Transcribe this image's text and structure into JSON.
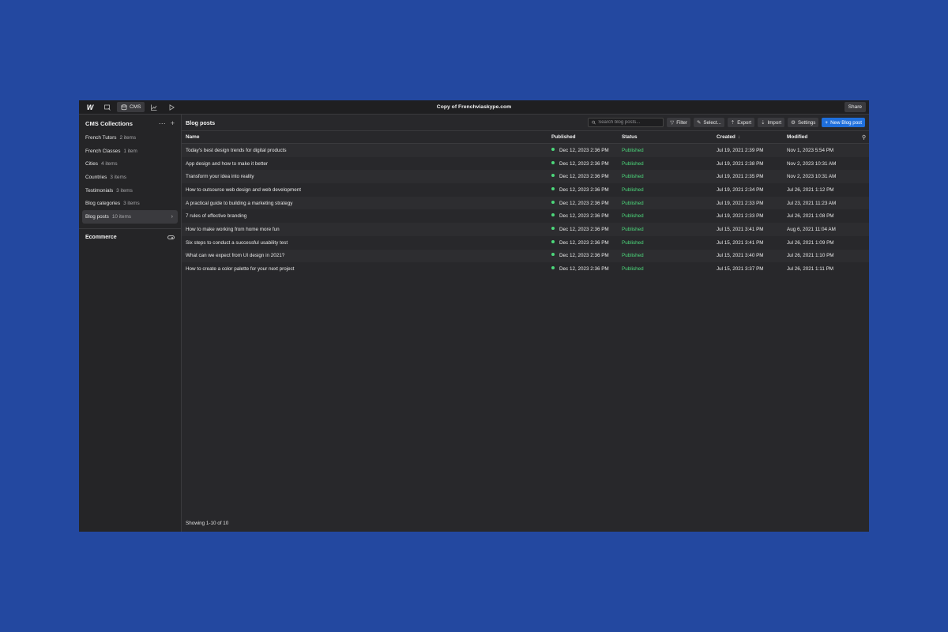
{
  "app": {
    "title": "Copy of Frenchviaskype.com",
    "share_label": "Share",
    "cms_label": "CMS"
  },
  "sidebar": {
    "title": "CMS Collections",
    "items": [
      {
        "name": "French Tutors",
        "count": "2 items"
      },
      {
        "name": "French Classes",
        "count": "1 item"
      },
      {
        "name": "Cities",
        "count": "4 items"
      },
      {
        "name": "Countries",
        "count": "3 items"
      },
      {
        "name": "Testimonials",
        "count": "3 items"
      },
      {
        "name": "Blog categories",
        "count": "3 items"
      },
      {
        "name": "Blog posts",
        "count": "10 items"
      }
    ],
    "section_ecommerce": "Ecommerce"
  },
  "content": {
    "title": "Blog posts",
    "search_placeholder": "Search blog posts...",
    "buttons": {
      "filter": "Filter",
      "select": "Select...",
      "export": "Export",
      "import": "Import",
      "settings": "Settings",
      "new": "New Blog post"
    },
    "columns": {
      "name": "Name",
      "published": "Published",
      "status": "Status",
      "created": "Created",
      "modified": "Modified"
    },
    "rows": [
      {
        "name": "Today's best design trends for digital products",
        "published": "Dec 12, 2023 2:36 PM",
        "status": "Published",
        "created": "Jul 19, 2021 2:39 PM",
        "modified": "Nov 1, 2023 5:54 PM"
      },
      {
        "name": "App design and how to make it better",
        "published": "Dec 12, 2023 2:36 PM",
        "status": "Published",
        "created": "Jul 19, 2021 2:38 PM",
        "modified": "Nov 2, 2023 10:31 AM"
      },
      {
        "name": "Transform your idea into reality",
        "published": "Dec 12, 2023 2:36 PM",
        "status": "Published",
        "created": "Jul 19, 2021 2:35 PM",
        "modified": "Nov 2, 2023 10:31 AM"
      },
      {
        "name": "How to outsource web design and web development",
        "published": "Dec 12, 2023 2:36 PM",
        "status": "Published",
        "created": "Jul 19, 2021 2:34 PM",
        "modified": "Jul 26, 2021 1:12 PM"
      },
      {
        "name": "A practical guide to building a marketing strategy",
        "published": "Dec 12, 2023 2:36 PM",
        "status": "Published",
        "created": "Jul 19, 2021 2:33 PM",
        "modified": "Jul 23, 2021 11:23 AM"
      },
      {
        "name": "7 rules of effective branding",
        "published": "Dec 12, 2023 2:36 PM",
        "status": "Published",
        "created": "Jul 19, 2021 2:33 PM",
        "modified": "Jul 26, 2021 1:08 PM"
      },
      {
        "name": "How to make working from home more fun",
        "published": "Dec 12, 2023 2:36 PM",
        "status": "Published",
        "created": "Jul 15, 2021 3:41 PM",
        "modified": "Aug 6, 2021 11:04 AM"
      },
      {
        "name": "Six steps to conduct a successful usability test",
        "published": "Dec 12, 2023 2:36 PM",
        "status": "Published",
        "created": "Jul 15, 2021 3:41 PM",
        "modified": "Jul 26, 2021 1:09 PM"
      },
      {
        "name": "What can we expect from UI design in 2021?",
        "published": "Dec 12, 2023 2:36 PM",
        "status": "Published",
        "created": "Jul 15, 2021 3:40 PM",
        "modified": "Jul 26, 2021 1:10 PM"
      },
      {
        "name": "How to create a color palette for your next project",
        "published": "Dec 12, 2023 2:36 PM",
        "status": "Published",
        "created": "Jul 15, 2021 3:37 PM",
        "modified": "Jul 26, 2021 1:11 PM"
      }
    ],
    "footer": "Showing 1-10 of 10"
  },
  "colors": {
    "background": "#2348a0",
    "published_dot": "#4cd97b",
    "primary_button": "#1f6fdc"
  }
}
